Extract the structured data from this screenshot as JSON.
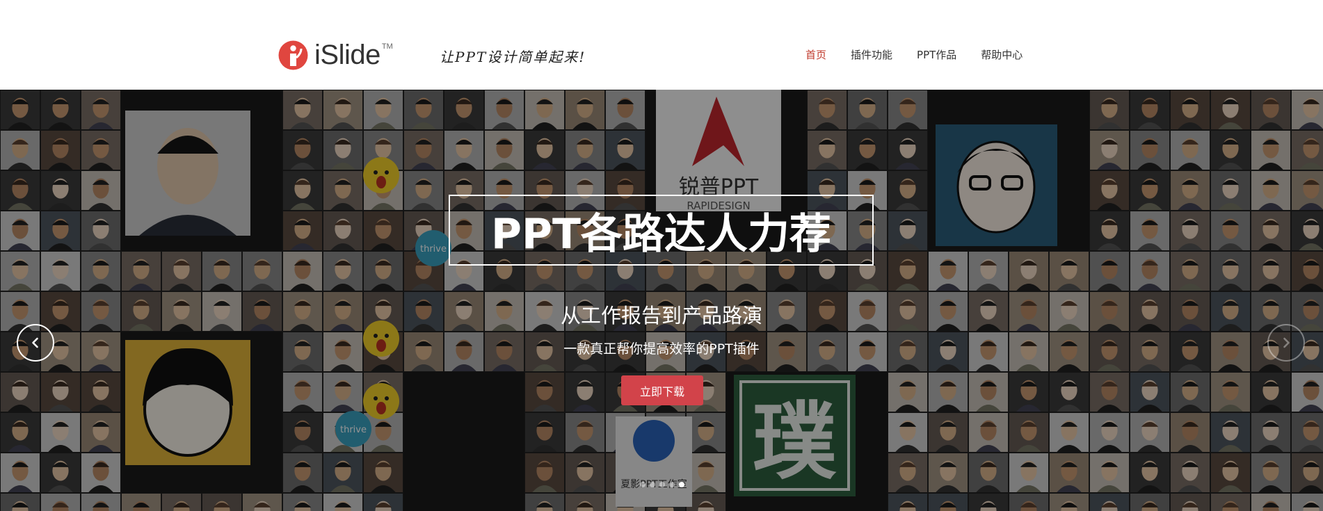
{
  "header": {
    "logo_text": "iSlide",
    "logo_tm": "TM",
    "slogan": "让PPT设计简单起来!",
    "nav": [
      {
        "label": "首页",
        "active": true
      },
      {
        "label": "插件功能",
        "active": false
      },
      {
        "label": "PPT作品",
        "active": false
      },
      {
        "label": "帮助中心",
        "active": false
      }
    ]
  },
  "hero": {
    "title": "PPT各路达人力荐",
    "subtitle": "从工作报告到产品路演",
    "tagline": "一款真正帮你提高效率的PPT插件",
    "cta_label": "立即下载",
    "prev_icon": "chevron-left-icon",
    "next_icon": "chevron-right-icon",
    "slide_count": 5,
    "active_slide": 5,
    "mosaic_labels": {
      "ruipu": "锐普PPT",
      "ruipu_sub": "RAPIDESIGN",
      "xiaying": "夏影PPT工作室",
      "pu": "璞",
      "thrive": "thrive"
    }
  },
  "colors": {
    "accent": "#d2434a",
    "nav_active": "#c0392b",
    "logo_red": "#e0463f"
  }
}
